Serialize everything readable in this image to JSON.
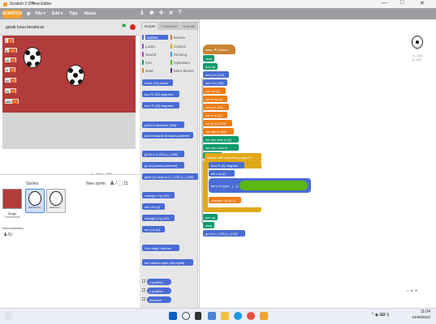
{
  "window": {
    "title": "Scratch 2 Offline Editor",
    "controls": [
      "—",
      "□",
      "✕"
    ]
  },
  "menubar": {
    "logo": "SCRATCH",
    "items": [
      "File ▾",
      "Edit ▾",
      "Tips",
      "About"
    ],
    "tools": [
      "⇩",
      "✥",
      "✢",
      "✕",
      "?"
    ]
  },
  "stage": {
    "project_name": "gerak lurus beraturan",
    "coords": "x: -100  y: -165",
    "monitors": [
      {
        "label": "t",
        "value": "1"
      },
      {
        "label": "g",
        "value": "10"
      },
      {
        "label": "vo",
        "value": "0"
      },
      {
        "label": "vt",
        "value": "0"
      },
      {
        "label": "yo",
        "value": "0"
      },
      {
        "label": "xo",
        "value": "0"
      },
      {
        "label": "alfa",
        "value": "0"
      }
    ]
  },
  "sprites": {
    "title": "Sprites",
    "new_sprite": "New sprite:",
    "stage_label": "Stage",
    "stage_sub": "2 backdrops",
    "new_backdrop": "New backdrop:",
    "items": [
      "Ball-Soccer",
      "Ball-Socc..."
    ]
  },
  "palette": {
    "tabs": [
      "Scripts",
      "Costumes",
      "Sounds"
    ],
    "categories": [
      "Motion",
      "Looks",
      "Sound",
      "Pen",
      "Data",
      "Events",
      "Control",
      "Sensing",
      "Operators",
      "More Blocks"
    ],
    "blocks": [
      "move (10) steps",
      "turn ↻ (15) degrees",
      "turn ↺ (15) degrees",
      "point in direction (90▾)",
      "point towards (mouse-pointer▾)",
      "go to x: (-131) y: (-185)",
      "go to (mouse-pointer▾)",
      "glide (1) secs to x: (-131) y: (-185)",
      "change x by (10)",
      "set x to (0)",
      "change y by (10)",
      "set y to (0)",
      "if on edge, bounce",
      "set rotation style (left-right▾)",
      "x position",
      "y position",
      "direction"
    ]
  },
  "scripts": {
    "blocks": [
      "when ⚑ clicked",
      "clear",
      "pen up",
      "set y to (120)",
      "set x to (-50)",
      "set t to (0)",
      "set vo to (0)",
      "set g to (10)",
      "set vt to (0)",
      "set yo to (120)",
      "set alfa to (45)",
      "set pen size to (3)",
      "set pen color to",
      "pen down",
      "repeat until <(touching edge?)>",
      "turn ↻ (0) degrees",
      "set x to (t)",
      "set y to ((yo) - (...))",
      "change t by (0.1)",
      "pen up",
      "clear",
      "go to x: (-131) y: (120)"
    ],
    "sprite_info": "x: -131\ny: 120",
    "zoom": [
      "−",
      "=",
      "+"
    ]
  },
  "taskbar": {
    "time": "11:04",
    "date": "24/06/2022",
    "tray": "^ ◉ ⌨ ))"
  }
}
